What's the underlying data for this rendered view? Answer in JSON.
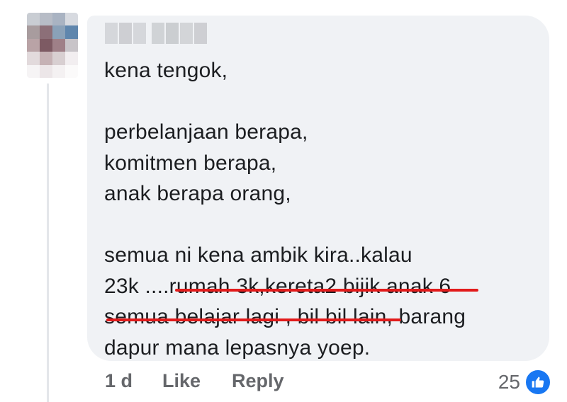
{
  "comment": {
    "lines": [
      "kena tengok,",
      "perbelanjaan berapa,",
      "komitmen berapa,",
      "anak berapa orang,",
      "semua ni kena ambik kira..kalau",
      "23k ....rumah 3k,kereta2 bijik anak 6",
      "semua belajar lagi , bil bil lain, barang",
      "dapur mana lepasnya yoep."
    ]
  },
  "actions": {
    "time": "1 d",
    "like_label": "Like",
    "reply_label": "Reply"
  },
  "reactions": {
    "count": "25",
    "icon": "thumbs-up-icon",
    "badge_color": "#1877f2"
  },
  "colors": {
    "bubble": "#f0f2f5",
    "underline": "#e21b1b",
    "text": "#1c1e21",
    "meta": "#65676b"
  }
}
